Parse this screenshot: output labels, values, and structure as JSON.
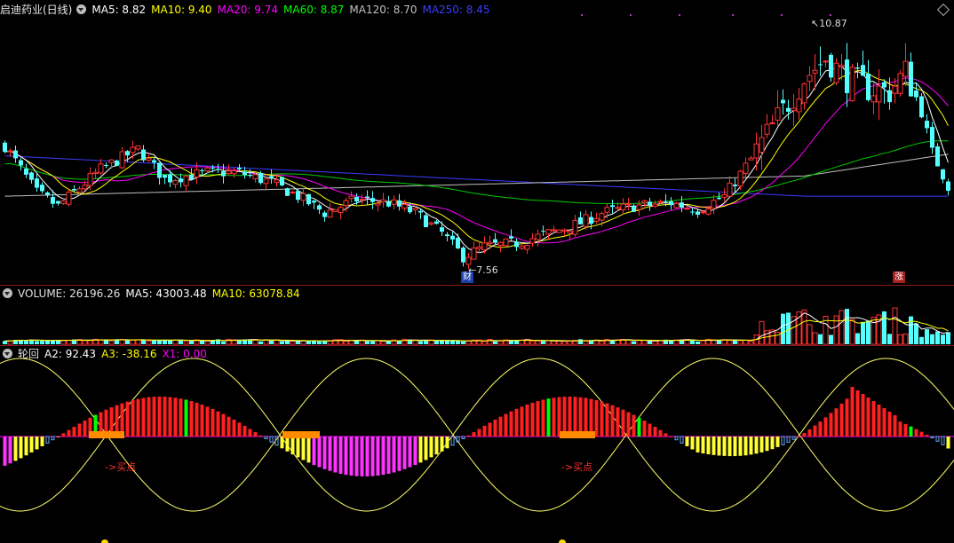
{
  "colors": {
    "up": "#ff3232",
    "down": "#54ffff",
    "ma5": "#ffffff",
    "ma10": "#ffff00",
    "ma20": "#ff00ff",
    "ma60": "#00cc00",
    "ma120": "#c0c0c0",
    "ma250": "#3c3cff",
    "separator": "#8b1a1a"
  },
  "header": {
    "title": "启迪药业(日线)",
    "ma5": "MA5: 8.82",
    "ma10": "MA10: 9.40",
    "ma20": "MA20: 9.74",
    "ma60": "MA60: 8.87",
    "ma120": "MA120: 8.70",
    "ma250": "MA250: 8.45"
  },
  "volume_header": {
    "label": "VOLUME: 26196.26",
    "ma5": "MA5: 43003.48",
    "ma10": "MA10: 63078.84"
  },
  "cycle_header": {
    "label": "轮回",
    "a2": "A2: 92.43",
    "a3": "A3: -38.16",
    "x1": "X1: 0.00"
  },
  "annotations": {
    "high": "10.87",
    "low": "7.56",
    "badge_finance": "财",
    "badge_rise": "涨",
    "buy1": "->买点",
    "buy2": "->买点"
  },
  "chart_data": {
    "type": "candlestick",
    "price_range": [
      7.3,
      11.2
    ],
    "anchors": [
      [
        0,
        9.3
      ],
      [
        6,
        8.6
      ],
      [
        10,
        8.4
      ],
      [
        18,
        8.95
      ],
      [
        25,
        9.25
      ],
      [
        30,
        8.8
      ],
      [
        38,
        8.9
      ],
      [
        44,
        8.9
      ],
      [
        50,
        8.75
      ],
      [
        55,
        8.55
      ],
      [
        60,
        8.3
      ],
      [
        66,
        8.5
      ],
      [
        72,
        8.45
      ],
      [
        77,
        8.3
      ],
      [
        82,
        8.0
      ],
      [
        86,
        7.65
      ],
      [
        90,
        7.8
      ],
      [
        96,
        7.85
      ],
      [
        102,
        8.0
      ],
      [
        108,
        8.15
      ],
      [
        112,
        8.3
      ],
      [
        118,
        8.4
      ],
      [
        125,
        8.45
      ],
      [
        130,
        8.35
      ],
      [
        135,
        8.55
      ],
      [
        140,
        9.1
      ],
      [
        145,
        9.7
      ],
      [
        150,
        10.3
      ],
      [
        154,
        10.6
      ],
      [
        158,
        10.3
      ],
      [
        162,
        10.15
      ],
      [
        166,
        10.1
      ],
      [
        169,
        10.4
      ],
      [
        172,
        9.8
      ],
      [
        174,
        9.2
      ],
      [
        177,
        8.7
      ]
    ],
    "volume_range": [
      0,
      100000
    ],
    "volume_last": 26196.26,
    "volume_ma5": 43003.48,
    "volume_ma10": 63078.84,
    "cycle_values": {
      "A2": 92.43,
      "A3": -38.16,
      "X1": 0.0
    }
  }
}
